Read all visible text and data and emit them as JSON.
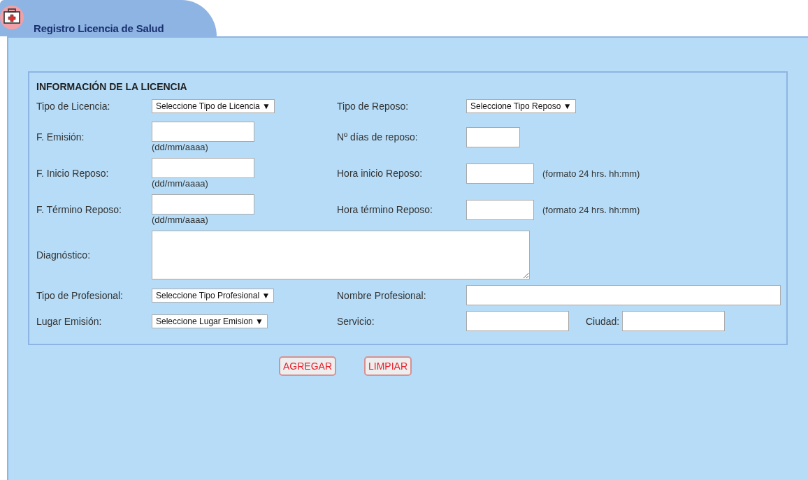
{
  "tab": {
    "title": "Registro Licencia de Salud"
  },
  "section": {
    "heading": "INFORMACIÓN DE LA LICENCIA",
    "rows": [
      {
        "left": {
          "label": "Tipo de Licencia:",
          "kind": "select",
          "value": "Seleccione Tipo de Licencia"
        },
        "right": {
          "label": "Tipo de Reposo:",
          "kind": "select",
          "value": "Seleccione Tipo Reposo"
        }
      },
      {
        "left": {
          "label": "F. Emisión:",
          "kind": "date",
          "hint": "(dd/mm/aaaa)"
        },
        "right": {
          "label": "Nº días de reposo:",
          "kind": "number"
        }
      },
      {
        "left": {
          "label": "F. Inicio Reposo:",
          "kind": "date",
          "hint": "(dd/mm/aaaa)"
        },
        "right": {
          "label": "Hora inicio Reposo:",
          "kind": "time",
          "hint": "(formato 24 hrs. hh:mm)"
        }
      },
      {
        "left": {
          "label": "F. Término Reposo:",
          "kind": "date",
          "hint": "(dd/mm/aaaa)"
        },
        "right": {
          "label": "Hora término Reposo:",
          "kind": "time",
          "hint": "(formato 24 hrs. hh:mm)"
        }
      },
      {
        "left": {
          "label": "Diagnóstico:",
          "kind": "textarea"
        }
      },
      {
        "left": {
          "label": "Tipo de Profesional:",
          "kind": "select",
          "value": "Seleccione Tipo Profesional"
        },
        "right": {
          "label": "Nombre Profesional:",
          "kind": "wide"
        }
      },
      {
        "left": {
          "label": "Lugar Emisión:",
          "kind": "select",
          "value": "Seleccione Lugar Emision"
        },
        "right": {
          "label": "Servicio:",
          "kind": "pair",
          "second_label": "Ciudad:"
        }
      }
    ]
  },
  "buttons": [
    {
      "label": "AGREGAR"
    },
    {
      "label": "LIMPIAR"
    }
  ],
  "select_arrow": "▼"
}
